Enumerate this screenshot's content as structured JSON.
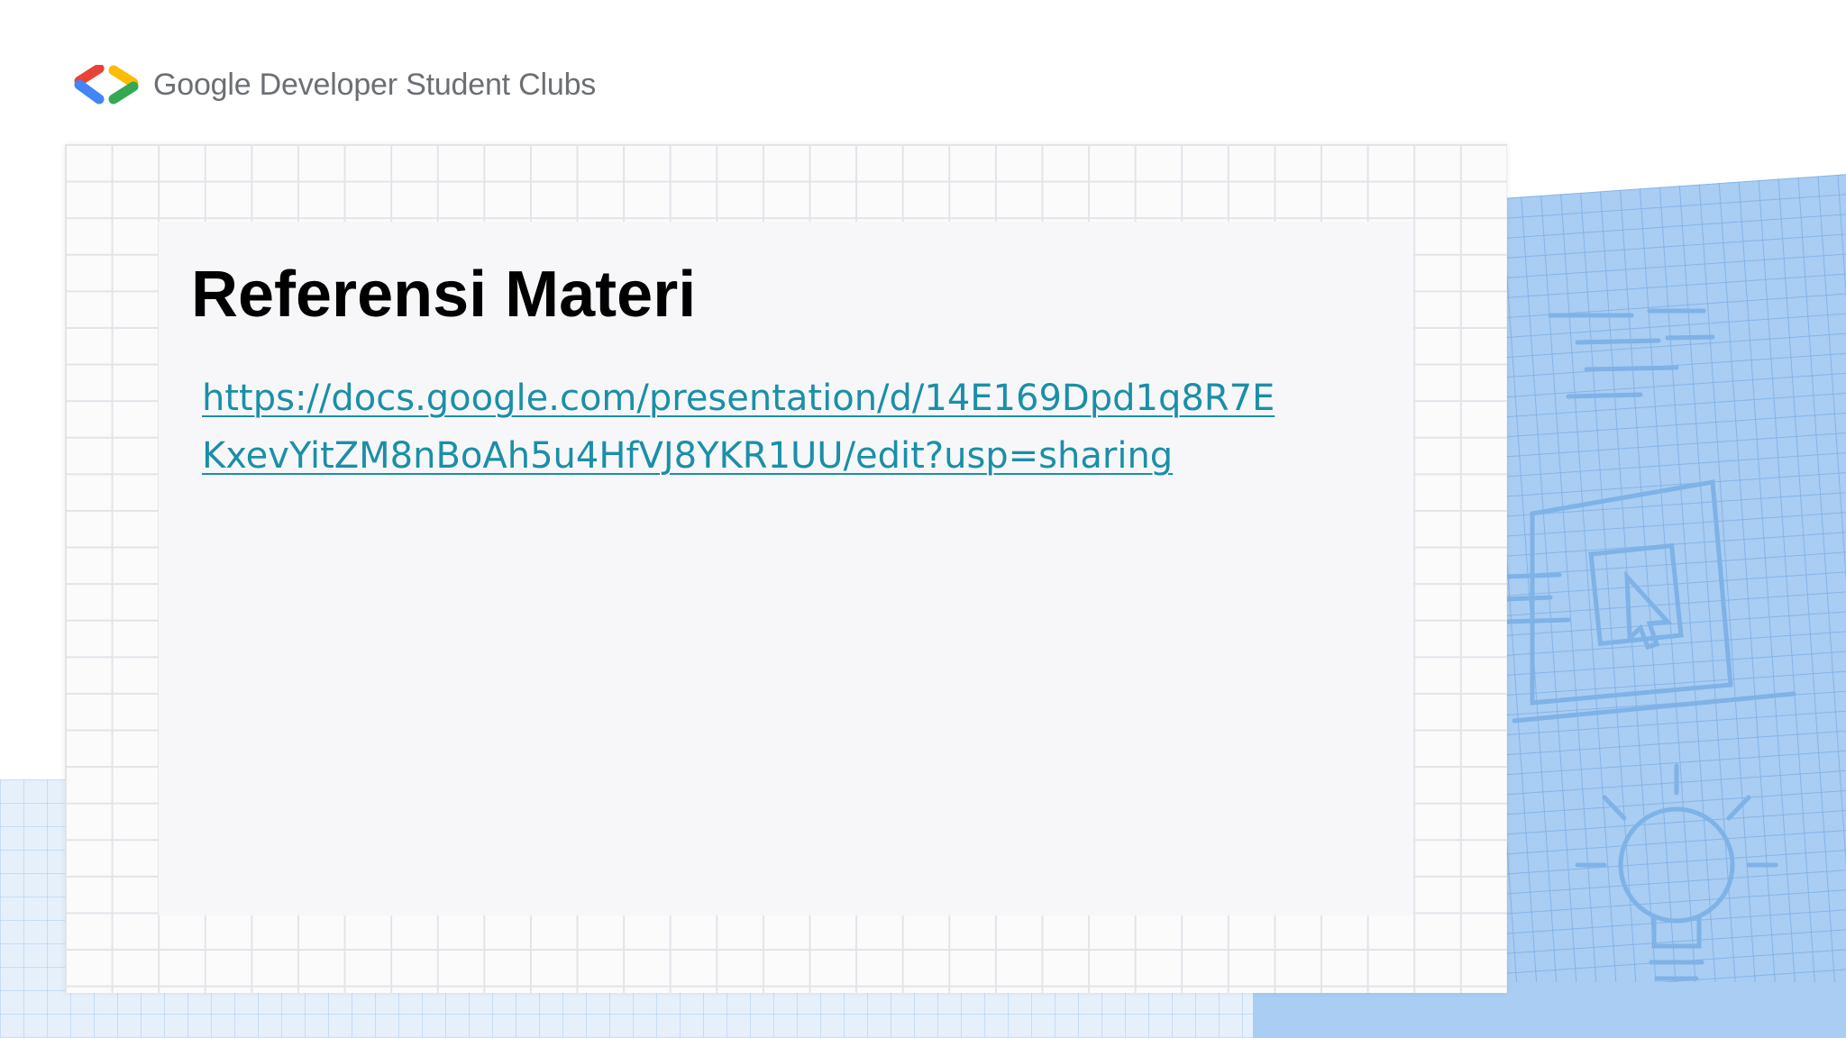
{
  "header": {
    "brand": "Google Developer Student Clubs",
    "logo_icon": "gdsc-chevrons-icon",
    "logo_colors": [
      "#ea4335",
      "#4285f4",
      "#34a853",
      "#fbbc04"
    ]
  },
  "slide": {
    "title": "Referensi Materi",
    "link": {
      "line1": "https://docs.google.com/presentation/d/14E169Dpd1q8R7E",
      "line2": "KxevYitZM8nBoAh5u4HfVJ8YKR1UU/edit?usp=sharing",
      "color": "#1a8fa8"
    }
  },
  "decorations": {
    "laptop": "laptop-illustration-icon",
    "lightbulb": "lightbulb-illustration-icon",
    "accent_blue": "#a9cdf3"
  }
}
